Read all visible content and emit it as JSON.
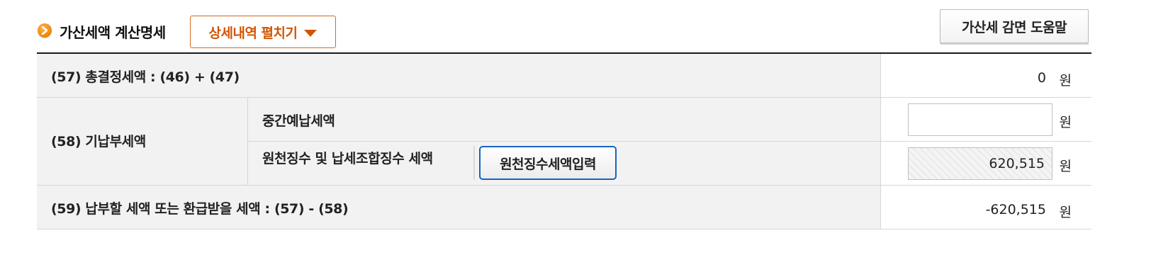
{
  "header": {
    "title": "가산세액 계산명세",
    "expand_label": "상세내역 펼치기",
    "help_label": "가산세 감면 도움말"
  },
  "rows": {
    "r57": {
      "label": "(57) 총결정세액 : (46) + (47)",
      "amount": "0",
      "unit": "원"
    },
    "r58": {
      "label": "(58) 기납부세액",
      "sub1": {
        "label": "중간예납세액",
        "value": "",
        "unit": "원"
      },
      "sub2": {
        "label": "원천징수 및 납세조합징수 세액",
        "button": "원천징수세액입력",
        "value": "620,515",
        "unit": "원"
      }
    },
    "r59": {
      "label": "(59) 납부할 세액 또는 환급받을 세액 : (57) - (58)",
      "amount": "-620,515",
      "unit": "원"
    }
  },
  "colors": {
    "accent": "#d35400",
    "focus": "#1565c0",
    "header_border": "#1a1a1a"
  },
  "icons": {
    "bullet": "chevron-right-circle-icon",
    "expand": "caret-down-icon"
  }
}
